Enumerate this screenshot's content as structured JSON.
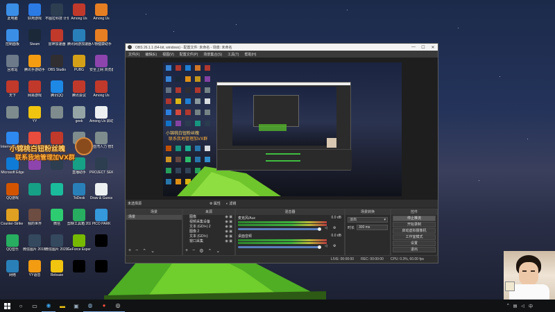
{
  "desktop": {
    "columns": [
      [
        {
          "label": "此电脑",
          "icon": "computer-icon",
          "color": "#3a8ee6"
        },
        {
          "label": "控制面板",
          "icon": "control-panel-icon",
          "color": "#3a8ee6"
        },
        {
          "label": "回收站",
          "icon": "recycle-bin-icon",
          "color": "#6c7a89"
        },
        {
          "label": "天下",
          "icon": "app-icon",
          "color": "#c0392b"
        },
        {
          "label": "",
          "icon": "app-icon",
          "color": "#7f8c8d"
        },
        {
          "label": "Internet Explorer",
          "icon": "ie-icon",
          "color": "#2d89ef"
        },
        {
          "label": "Microsoft Edge",
          "icon": "edge-icon",
          "color": "#0f7bd6"
        },
        {
          "label": "QQ游戏",
          "icon": "game-icon",
          "color": "#d35400"
        },
        {
          "label": "Counter-Strike Global Off...",
          "icon": "csgo-icon",
          "color": "#e0a021"
        },
        {
          "label": "QQ音乐",
          "icon": "music-icon",
          "color": "#27ae60"
        },
        {
          "label": "网络",
          "icon": "network-icon",
          "color": "#2980b9"
        }
      ],
      [
        {
          "label": "好用游戏",
          "icon": "app-icon",
          "color": "#2c7be5"
        },
        {
          "label": "Steam",
          "icon": "steam-icon",
          "color": "#1b2838"
        },
        {
          "label": "腾讯手游助手",
          "icon": "app-icon",
          "color": "#f39c12"
        },
        {
          "label": "网易游戏",
          "icon": "app-icon",
          "color": "#c0392b"
        },
        {
          "label": "YY",
          "icon": "app-icon",
          "color": "#f1c40f"
        },
        {
          "label": "Google Chrome",
          "icon": "chrome-icon",
          "color": "#e74c3c"
        },
        {
          "label": "",
          "icon": "app-icon",
          "color": "#8e44ad"
        },
        {
          "label": "",
          "icon": "app-icon",
          "color": "#16a085"
        },
        {
          "label": "我的世界",
          "icon": "app-icon",
          "color": "#6d4c41"
        },
        {
          "label": "微信图片 20181015...",
          "icon": "image-icon",
          "color": "#34495e"
        },
        {
          "label": "YY语音",
          "icon": "app-icon",
          "color": "#f39c12"
        }
      ],
      [
        {
          "label": "不图拉科技 计划",
          "icon": "app-icon",
          "color": "#2c3e50"
        },
        {
          "label": "雷神加速器",
          "icon": "app-icon",
          "color": "#c0392b"
        },
        {
          "label": "OBS Studio",
          "icon": "obs-icon",
          "color": "#302e31"
        },
        {
          "label": "腾讯QQ",
          "icon": "qq-icon",
          "color": "#1e88e5"
        },
        {
          "label": "",
          "icon": "app-icon",
          "color": "#7f8c8d"
        },
        {
          "label": "Outbrid",
          "icon": "app-icon",
          "color": "#c0392b"
        },
        {
          "label": "",
          "icon": "app-icon",
          "color": "#2c3e50"
        },
        {
          "label": "",
          "icon": "app-icon",
          "color": "#1abc9c"
        },
        {
          "label": "微信",
          "icon": "wechat-icon",
          "color": "#2ecc71"
        },
        {
          "label": "微信图片 20201010...",
          "icon": "image-icon",
          "color": "#34495e"
        },
        {
          "label": "Release",
          "icon": "folder-icon",
          "color": "#f1c40f"
        }
      ],
      [
        {
          "label": "Among Us",
          "icon": "amongus-icon",
          "color": "#c0392b"
        },
        {
          "label": "腾讯网游加速器",
          "icon": "app-icon",
          "color": "#2980b9"
        },
        {
          "label": "PUBG",
          "icon": "pubg-icon",
          "color": "#d4a017"
        },
        {
          "label": "腾讯会议",
          "icon": "app-icon",
          "color": "#c0392b"
        },
        {
          "label": "geek",
          "icon": "app-icon",
          "color": "#95a5a6"
        },
        {
          "label": "",
          "icon": "app-icon",
          "color": "#7f8c8d"
        },
        {
          "label": "直播助手",
          "icon": "app-icon",
          "color": "#16a085"
        },
        {
          "label": "ToDesk",
          "icon": "todesk-icon",
          "color": "#2980b9"
        },
        {
          "label": "剪映工具箱 2020",
          "icon": "app-icon",
          "color": "#27ae60"
        },
        {
          "label": "GeForce Experience",
          "icon": "nvidia-icon",
          "color": "#76b900"
        },
        {
          "label": "",
          "icon": "app-icon",
          "color": "#000000"
        }
      ],
      [
        {
          "label": "Among Us",
          "icon": "amongus-icon",
          "color": "#e67e22"
        },
        {
          "label": "人物健康助手",
          "icon": "app-icon",
          "color": "#e67e22"
        },
        {
          "label": "安全上网 浏览器",
          "icon": "app-icon",
          "color": "#8e44ad"
        },
        {
          "label": "Among Us",
          "icon": "amongus-icon",
          "color": "#c0392b"
        },
        {
          "label": "Among Us 启动",
          "icon": "amongus-icon",
          "color": "#ecf0f1"
        },
        {
          "label": "大亚湾人力 管理",
          "icon": "app-icon",
          "color": "#7f8c8d"
        },
        {
          "label": "PROJECT SEKAI",
          "icon": "app-icon",
          "color": "#2c3e50"
        },
        {
          "label": "Draw & Guess",
          "icon": "app-icon",
          "color": "#ecf0f1"
        },
        {
          "label": "PICO PARK",
          "icon": "app-icon",
          "color": "#3498db"
        },
        {
          "label": "",
          "icon": "app-icon",
          "color": "#000000"
        },
        {
          "label": "",
          "icon": "app-icon",
          "color": "#000000"
        }
      ]
    ],
    "banner_line1": "小锦桃白钮粉丝魄",
    "banner_line2": "联系我地管理加VX群"
  },
  "obs": {
    "title": "OBS 26.1.1 (64-bit, windows) - 配置文件: 未命名 - 场景: 未命名",
    "menu": [
      "文件(F)",
      "编辑(E)",
      "视图(V)",
      "配置文件(P)",
      "场景集合(S)",
      "工具(T)",
      "帮助(H)"
    ],
    "dock_header": {
      "label": "未选择源",
      "props": "属性",
      "filters": "滤镜"
    },
    "scenes": {
      "title": "场景",
      "items": [
        "场景"
      ]
    },
    "sources": {
      "title": "来源",
      "items": [
        "图像",
        "视频采集设备",
        "文本 (GDI+) 2",
        "图像 2",
        "文本 (GDI+)",
        "窗口采集"
      ]
    },
    "mixer": {
      "title": "混音器",
      "channels": [
        {
          "name": "麦克风/Aux",
          "db": "0.0 dB"
        },
        {
          "name": "桌面音频",
          "db": "0.0 dB"
        }
      ]
    },
    "transitions": {
      "title": "场景转换",
      "type": "淡出",
      "duration_label": "时长",
      "duration": "300 ms"
    },
    "controls": {
      "title": "控件",
      "buttons": [
        "停止推流",
        "开始录制",
        "启动虚拟摄像机",
        "工作室模式",
        "设置",
        "退出"
      ]
    },
    "status": {
      "live": "LIVE: 00:00:00",
      "rec": "REC: 00:00:00",
      "cpu": "CPU: 0.3%, 60.00 fps"
    }
  },
  "taskbar": {
    "items": [
      "start-icon",
      "search-icon",
      "task-view-icon",
      "edge-icon",
      "explorer-icon",
      "steam-icon",
      "chrome-icon",
      "obs-icon"
    ],
    "tray_text": "中"
  }
}
